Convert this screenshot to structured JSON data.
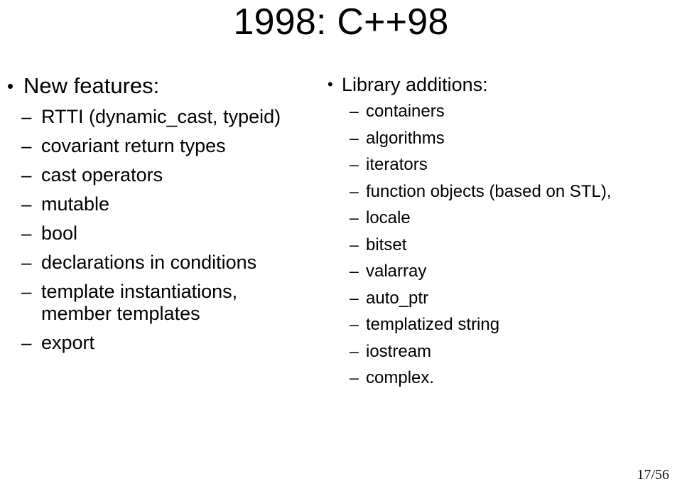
{
  "slide": {
    "title": "1998: C++98",
    "page_number": "17/56",
    "bullet_glyph": "•",
    "dash_glyph": "–",
    "background_color": "#ffffff",
    "text_color": "#000000"
  },
  "left_column": {
    "heading": "New features:",
    "items": [
      "RTTI (dynamic_cast, typeid)",
      "covariant return types",
      "cast operators",
      "mutable",
      "bool",
      "declarations in conditions",
      "template instantiations, member templates",
      "export"
    ]
  },
  "right_column": {
    "heading": "Library additions:",
    "items": [
      "containers",
      "algorithms",
      "iterators",
      "function objects (based on STL),",
      "locale",
      "bitset",
      "valarray",
      "auto_ptr",
      "templatized string",
      "iostream",
      "complex."
    ]
  }
}
